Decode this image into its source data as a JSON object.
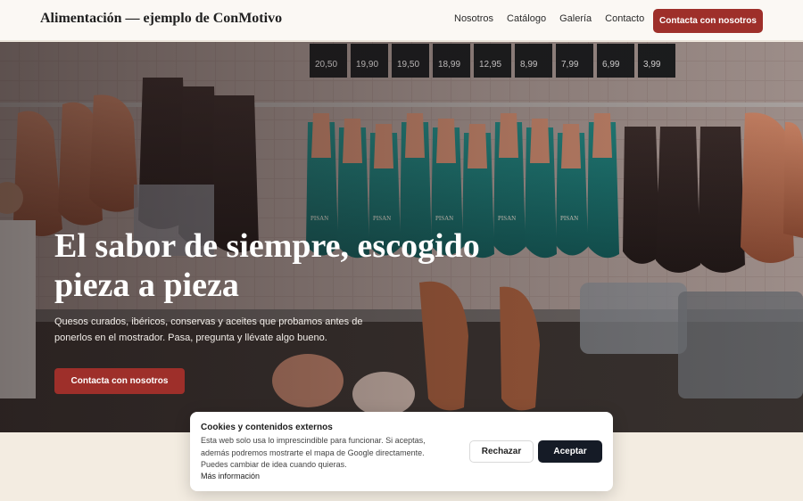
{
  "header": {
    "brand": "Alimentación — ejemplo de ConMotivo",
    "nav": [
      "Nosotros",
      "Catálogo",
      "Galería",
      "Contacto"
    ],
    "cta_label": "Contacta con nosotros"
  },
  "hero": {
    "title": "El sabor de siempre, escogido pieza a pieza",
    "subtitle": "Quesos curados, ibéricos, conservas y aceites que probamos antes de ponerlos en el mostrador. Pasa, pregunta y llévate algo bueno.",
    "cta_label": "Contacta con nosotros",
    "price_tags": [
      "20,50",
      "19,90",
      "19,50",
      "18,99",
      "12,95",
      "8,99",
      "7,99",
      "6,99",
      "3,99"
    ],
    "label_brand": "PISAN"
  },
  "cookie_banner": {
    "title": "Cookies y contenidos externos",
    "text": "Esta web solo usa lo imprescindible para funcionar. Si aceptas, además podremos mostrarte el mapa de Google directamente. Puedes cambiar de idea cuando quieras.",
    "more_link": "Más información",
    "reject_label": "Rechazar",
    "accept_label": "Aceptar"
  },
  "colors": {
    "accent": "#9e2f2a",
    "dark_button": "#151b26",
    "header_bg": "#fbf8f4",
    "page_bg": "#f3ece1"
  }
}
